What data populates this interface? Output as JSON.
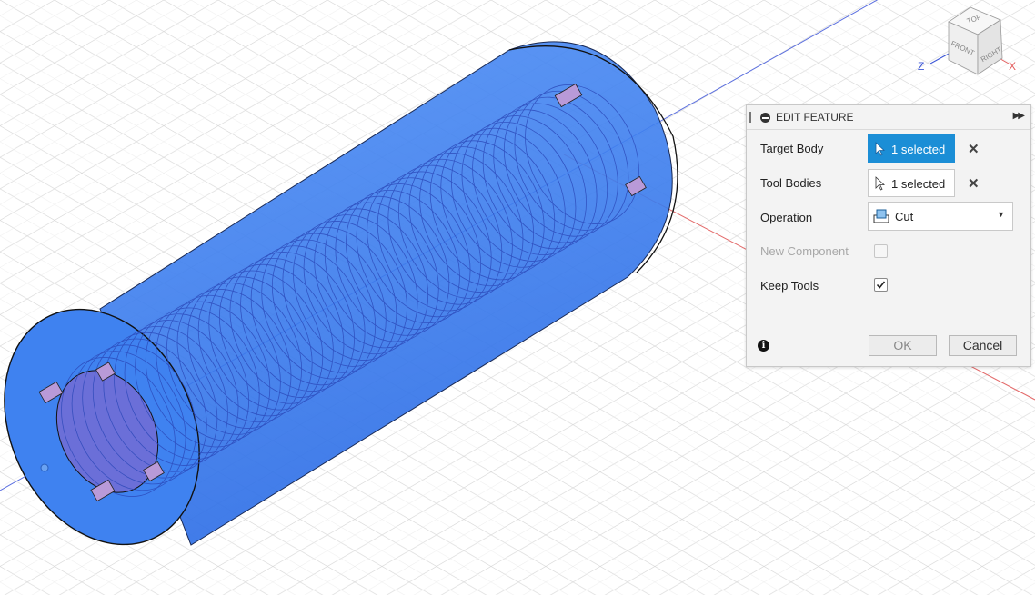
{
  "dialog": {
    "title": "EDIT FEATURE",
    "target_body": {
      "label": "Target Body",
      "value": "1 selected"
    },
    "tool_bodies": {
      "label": "Tool Bodies",
      "value": "1 selected"
    },
    "operation": {
      "label": "Operation",
      "value": "Cut"
    },
    "new_component": {
      "label": "New Component",
      "checked": false,
      "enabled": false
    },
    "keep_tools": {
      "label": "Keep Tools",
      "checked": true
    },
    "ok_label": "OK",
    "cancel_label": "Cancel"
  },
  "viewcube": {
    "top": "TOP",
    "front": "FRONT",
    "right": "RIGHT",
    "axis_z": "Z",
    "axis_x": "X"
  },
  "colors": {
    "accent": "#1b8ed6",
    "body_fill": "#3a7ff0",
    "axis_x": "#e35a5a",
    "axis_z": "#3b55d6"
  }
}
